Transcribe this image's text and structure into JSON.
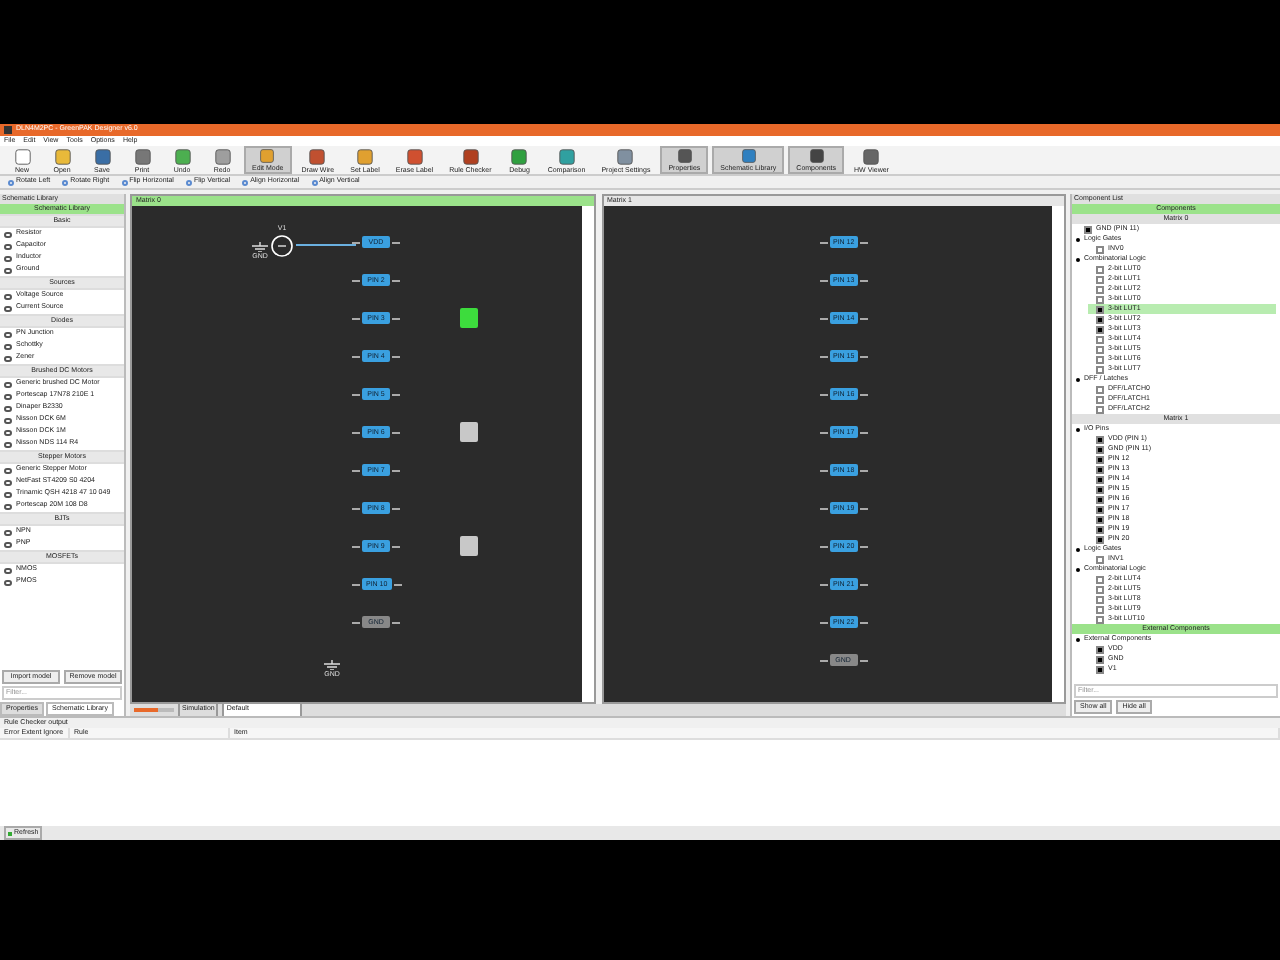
{
  "window": {
    "title": "DLN4M2PC - GreenPAK Designer v6.0"
  },
  "menu": [
    "File",
    "Edit",
    "View",
    "Tools",
    "Options",
    "Help"
  ],
  "toolbar": [
    {
      "label": "New",
      "kind": "new",
      "selected": false
    },
    {
      "label": "Open",
      "kind": "open",
      "selected": false
    },
    {
      "label": "Save",
      "kind": "save",
      "selected": false
    },
    {
      "label": "Print",
      "kind": "print",
      "selected": false
    },
    {
      "label": "Undo",
      "kind": "undo",
      "selected": false
    },
    {
      "label": "Redo",
      "kind": "redo",
      "selected": false
    },
    {
      "label": "Edit Mode",
      "kind": "edit",
      "selected": true
    },
    {
      "label": "Draw Wire",
      "kind": "wire",
      "selected": false
    },
    {
      "label": "Set Label",
      "kind": "label",
      "selected": false
    },
    {
      "label": "Erase Label",
      "kind": "erase",
      "selected": false
    },
    {
      "label": "Rule Checker",
      "kind": "bug",
      "selected": false
    },
    {
      "label": "Debug",
      "kind": "debug",
      "selected": false
    },
    {
      "label": "Comparison",
      "kind": "compare",
      "selected": false
    },
    {
      "label": "Project Settings",
      "kind": "settings",
      "selected": false
    },
    {
      "label": "Properties",
      "kind": "props",
      "selected": true
    },
    {
      "label": "Schematic Library",
      "kind": "lib",
      "selected": true
    },
    {
      "label": "Components",
      "kind": "comp",
      "selected": true
    },
    {
      "label": "HW Viewer",
      "kind": "hw",
      "selected": false
    }
  ],
  "toolbar2": [
    "Rotate Left",
    "Rotate Right",
    "Flip Horizontal",
    "Flip Vertical",
    "Align Horizontal",
    "Align Vertical"
  ],
  "library": {
    "title": "Schematic Library",
    "header": "Schematic Library",
    "groups": [
      {
        "name": "Basic",
        "items": [
          "Resistor",
          "Capacitor",
          "Inductor",
          "Ground"
        ]
      },
      {
        "name": "Sources",
        "items": [
          "Voltage Source",
          "Current Source"
        ]
      },
      {
        "name": "Diodes",
        "items": [
          "PN Junction",
          "Schottky",
          "Zener"
        ]
      },
      {
        "name": "Brushed DC Motors",
        "items": [
          "Generic brushed DC Motor",
          "Portescap 17N78 210E 1",
          "Dinaper B2330",
          "Nisson DCK 6M",
          "Nisson DCK 1M",
          "Nisson NDS 114 R4"
        ]
      },
      {
        "name": "Stepper Motors",
        "items": [
          "Generic Stepper Motor",
          "NetFast ST4209 S0 4204",
          "Trinamic QSH 4218 47 10 049",
          "Portescap 20M 108 D8"
        ]
      },
      {
        "name": "BJTs",
        "items": [
          "NPN",
          "PNP"
        ]
      },
      {
        "name": "MOSFETs",
        "items": [
          "NMOS",
          "PMOS"
        ]
      }
    ],
    "import": "Import model",
    "remove": "Remove model",
    "filter_placeholder": "Filter...",
    "tabs": [
      {
        "label": "Properties",
        "selected": false
      },
      {
        "label": "Schematic Library",
        "selected": true
      }
    ]
  },
  "matrix0": {
    "title": "Matrix 0",
    "source": "V1",
    "ground": "GND",
    "pins": [
      {
        "label": "VDD"
      },
      {
        "label": "PIN 2"
      },
      {
        "label": "PIN 3",
        "logic": {
          "selected": true
        }
      },
      {
        "label": "PIN 4"
      },
      {
        "label": "PIN 5"
      },
      {
        "label": "PIN 6",
        "logic": {
          "selected": false
        }
      },
      {
        "label": "PIN 7"
      },
      {
        "label": "PIN 8"
      },
      {
        "label": "PIN 9",
        "logic": {
          "selected": false
        }
      },
      {
        "label": "PIN 10"
      },
      {
        "label": "GND",
        "kind": "ground"
      }
    ],
    "ground2": "GND"
  },
  "matrix1": {
    "title": "Matrix 1",
    "pins": [
      {
        "label": "PIN 12"
      },
      {
        "label": "PIN 13"
      },
      {
        "label": "PIN 14"
      },
      {
        "label": "PIN 15"
      },
      {
        "label": "PIN 16"
      },
      {
        "label": "PIN 17"
      },
      {
        "label": "PIN 18"
      },
      {
        "label": "PIN 19"
      },
      {
        "label": "PIN 20"
      },
      {
        "label": "PIN 21"
      },
      {
        "label": "PIN 22"
      },
      {
        "label": "GND",
        "kind": "ground"
      }
    ]
  },
  "canvas_toolbar": {
    "simulation_label": "Simulation",
    "simulation": "Default",
    "zoom": {
      "level": 0.6
    }
  },
  "components": {
    "title": "Component List",
    "header": "Components",
    "sections": [
      {
        "name": "Matrix 0",
        "tree": [
          {
            "label": "GND (PIN 11)",
            "checked": true,
            "selected": false
          },
          {
            "label": "Logic Gates",
            "children": [
              {
                "label": "INV0",
                "checked": false,
                "selected": false
              }
            ]
          },
          {
            "label": "Combinatorial Logic",
            "children": [
              {
                "label": "2-bit LUT0",
                "checked": false,
                "selected": false
              },
              {
                "label": "2-bit LUT1",
                "checked": false,
                "selected": false
              },
              {
                "label": "2-bit LUT2",
                "checked": false,
                "selected": false
              },
              {
                "label": "3-bit LUT0",
                "checked": false,
                "selected": false
              },
              {
                "label": "3-bit LUT1",
                "checked": true,
                "selected": true
              },
              {
                "label": "3-bit LUT2",
                "checked": true,
                "selected": false
              },
              {
                "label": "3-bit LUT3",
                "checked": true,
                "selected": false
              },
              {
                "label": "3-bit LUT4",
                "checked": false,
                "selected": false
              },
              {
                "label": "3-bit LUT5",
                "checked": false,
                "selected": false
              },
              {
                "label": "3-bit LUT6",
                "checked": false,
                "selected": false
              },
              {
                "label": "3-bit LUT7",
                "checked": false,
                "selected": false
              }
            ]
          },
          {
            "label": "DFF / Latches",
            "children": [
              {
                "label": "DFF/LATCH0",
                "checked": false,
                "selected": false
              },
              {
                "label": "DFF/LATCH1",
                "checked": false,
                "selected": false
              },
              {
                "label": "DFF/LATCH2",
                "checked": false,
                "selected": false
              }
            ]
          }
        ]
      },
      {
        "name": "Matrix 1",
        "tree": [
          {
            "label": "I/O Pins",
            "children": [
              {
                "label": "VDD (PIN 1)",
                "checked": true,
                "selected": false
              },
              {
                "label": "GND (PIN 11)",
                "checked": true,
                "selected": false
              },
              {
                "label": "PIN 12",
                "checked": true,
                "selected": false
              },
              {
                "label": "PIN 13",
                "checked": true,
                "selected": false
              },
              {
                "label": "PIN 14",
                "checked": true,
                "selected": false
              },
              {
                "label": "PIN 15",
                "checked": true,
                "selected": false
              },
              {
                "label": "PIN 16",
                "checked": true,
                "selected": false
              },
              {
                "label": "PIN 17",
                "checked": true,
                "selected": false
              },
              {
                "label": "PIN 18",
                "checked": true,
                "selected": false
              },
              {
                "label": "PIN 19",
                "checked": true,
                "selected": false
              },
              {
                "label": "PIN 20",
                "checked": true,
                "selected": false
              }
            ]
          },
          {
            "label": "Logic Gates",
            "children": [
              {
                "label": "INV1",
                "checked": false,
                "selected": false
              }
            ]
          },
          {
            "label": "Combinatorial Logic",
            "children": [
              {
                "label": "2-bit LUT4",
                "checked": false,
                "selected": false
              },
              {
                "label": "2-bit LUT5",
                "checked": false,
                "selected": false
              },
              {
                "label": "3-bit LUT8",
                "checked": false,
                "selected": false
              },
              {
                "label": "3-bit LUT9",
                "checked": false,
                "selected": false
              },
              {
                "label": "3-bit LUT10",
                "checked": false,
                "selected": false
              }
            ]
          }
        ]
      }
    ],
    "external_header": "External Components",
    "external": {
      "label": "External Components",
      "children": [
        {
          "label": "VDD",
          "checked": true,
          "selected": false
        },
        {
          "label": "GND",
          "checked": true,
          "selected": false
        },
        {
          "label": "V1",
          "checked": true,
          "selected": false
        }
      ]
    },
    "filter_placeholder": "Filter...",
    "show_all": "Show all",
    "hide_all": "Hide all"
  },
  "rule_checker": {
    "title": "Rule Checker output",
    "columns": [
      "Error Extent Ignore",
      "Rule",
      "Item"
    ]
  },
  "status_bar": {
    "refresh": "Refresh"
  }
}
